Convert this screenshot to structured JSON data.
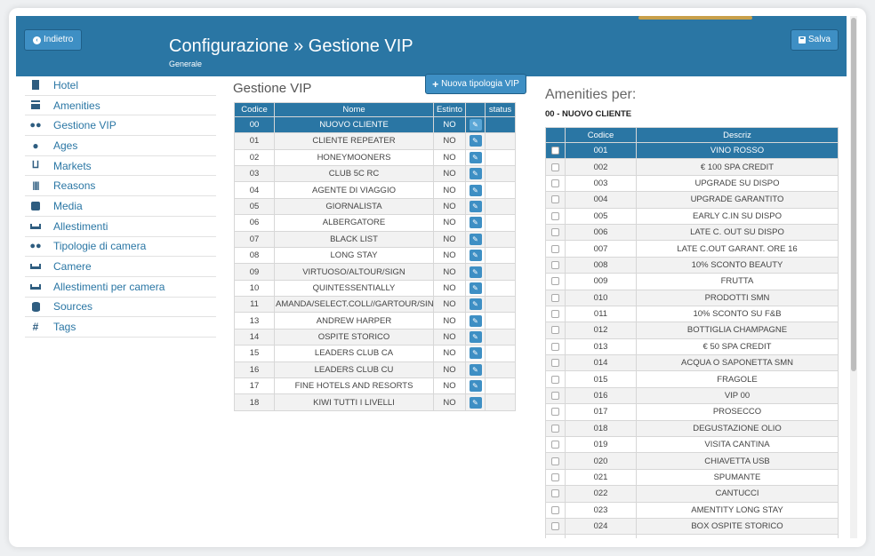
{
  "header": {
    "back_label": "Indietro",
    "title": "Configurazione » Gestione VIP",
    "subtitle": "Generale",
    "save_label": "Salva"
  },
  "sidebar": {
    "items": [
      {
        "label": "Hotel",
        "icon": "building-icon"
      },
      {
        "label": "Amenities",
        "icon": "gift-icon"
      },
      {
        "label": "Gestione VIP",
        "icon": "users-icon"
      },
      {
        "label": "Ages",
        "icon": "user-icon"
      },
      {
        "label": "Markets",
        "icon": "cart-icon"
      },
      {
        "label": "Reasons",
        "icon": "barcode-icon"
      },
      {
        "label": "Media",
        "icon": "phone-icon"
      },
      {
        "label": "Allestimenti",
        "icon": "bed-icon"
      },
      {
        "label": "Tipologie di camera",
        "icon": "users-icon"
      },
      {
        "label": "Camere",
        "icon": "bed-icon"
      },
      {
        "label": "Allestimenti per camera",
        "icon": "bed-icon"
      },
      {
        "label": "Sources",
        "icon": "database-icon"
      },
      {
        "label": "Tags",
        "icon": "hash-icon"
      }
    ]
  },
  "vip": {
    "title": "Gestione VIP",
    "new_button_label": "Nuova tipologia VIP",
    "columns": [
      "Codice",
      "Nome",
      "Estinto",
      "",
      "status"
    ],
    "rows": [
      {
        "code": "00",
        "name": "NUOVO CLIENTE",
        "estinto": "NO"
      },
      {
        "code": "01",
        "name": "CLIENTE REPEATER",
        "estinto": "NO"
      },
      {
        "code": "02",
        "name": "HONEYMOONERS",
        "estinto": "NO"
      },
      {
        "code": "03",
        "name": "CLUB 5C RC",
        "estinto": "NO"
      },
      {
        "code": "04",
        "name": "AGENTE DI VIAGGIO",
        "estinto": "NO"
      },
      {
        "code": "05",
        "name": "GIORNALISTA",
        "estinto": "NO"
      },
      {
        "code": "06",
        "name": "ALBERGATORE",
        "estinto": "NO"
      },
      {
        "code": "07",
        "name": "BLACK LIST",
        "estinto": "NO"
      },
      {
        "code": "08",
        "name": "LONG STAY",
        "estinto": "NO"
      },
      {
        "code": "09",
        "name": "VIRTUOSO/ALTOUR/SIGN",
        "estinto": "NO"
      },
      {
        "code": "10",
        "name": "QUINTESSENTIALLY",
        "estinto": "NO"
      },
      {
        "code": "11",
        "name": "AMANDA/SELECT.COLL//GARTOUR/SIN/C",
        "estinto": "NO"
      },
      {
        "code": "13",
        "name": "ANDREW HARPER",
        "estinto": "NO"
      },
      {
        "code": "14",
        "name": "OSPITE STORICO",
        "estinto": "NO"
      },
      {
        "code": "15",
        "name": "LEADERS CLUB CA",
        "estinto": "NO"
      },
      {
        "code": "16",
        "name": "LEADERS CLUB CU",
        "estinto": "NO"
      },
      {
        "code": "17",
        "name": "FINE HOTELS AND RESORTS",
        "estinto": "NO"
      },
      {
        "code": "18",
        "name": "KIWI TUTTI I LIVELLI",
        "estinto": "NO"
      }
    ]
  },
  "amenities": {
    "title": "Amenities per:",
    "subtitle": "00 - NUOVO CLIENTE",
    "columns": [
      "",
      "Codice",
      "Descriz"
    ],
    "rows": [
      {
        "code": "001",
        "desc": "VINO ROSSO"
      },
      {
        "code": "002",
        "desc": "€ 100 SPA CREDIT"
      },
      {
        "code": "003",
        "desc": "UPGRADE SU DISPO"
      },
      {
        "code": "004",
        "desc": "UPGRADE GARANTITO"
      },
      {
        "code": "005",
        "desc": "EARLY C.IN SU DISPO"
      },
      {
        "code": "006",
        "desc": "LATE C. OUT SU DISPO"
      },
      {
        "code": "007",
        "desc": "LATE C.OUT GARANT. ORE 16"
      },
      {
        "code": "008",
        "desc": "10% SCONTO BEAUTY"
      },
      {
        "code": "009",
        "desc": "FRUTTA"
      },
      {
        "code": "010",
        "desc": "PRODOTTI SMN"
      },
      {
        "code": "011",
        "desc": "10% SCONTO SU F&B"
      },
      {
        "code": "012",
        "desc": "BOTTIGLIA CHAMPAGNE"
      },
      {
        "code": "013",
        "desc": "€ 50 SPA CREDIT"
      },
      {
        "code": "014",
        "desc": "ACQUA O SAPONETTA SMN"
      },
      {
        "code": "015",
        "desc": "FRAGOLE"
      },
      {
        "code": "016",
        "desc": "VIP 00"
      },
      {
        "code": "017",
        "desc": "PROSECCO"
      },
      {
        "code": "018",
        "desc": "DEGUSTAZIONE OLIO"
      },
      {
        "code": "019",
        "desc": "VISITA CANTINA"
      },
      {
        "code": "020",
        "desc": "CHIAVETTA USB"
      },
      {
        "code": "021",
        "desc": "SPUMANTE"
      },
      {
        "code": "022",
        "desc": "CANTUCCI"
      },
      {
        "code": "023",
        "desc": "AMENTITY LONG STAY"
      },
      {
        "code": "024",
        "desc": "BOX OSPITE STORICO"
      },
      {
        "code": "",
        "desc": ""
      }
    ]
  },
  "colors": {
    "header_bg": "#2a76a4",
    "button_bg": "#3e8fc4",
    "link": "#2a76a4",
    "selected_row": "#2a76a4"
  }
}
